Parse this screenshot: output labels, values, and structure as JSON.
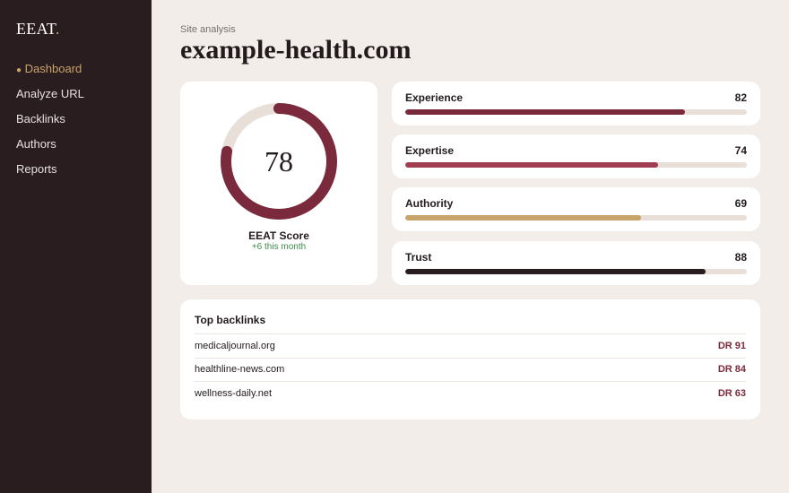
{
  "app": {
    "logo_text": "EEAT",
    "logo_dot": "."
  },
  "sidebar": {
    "items": [
      {
        "label": "Dashboard",
        "active": true
      },
      {
        "label": "Analyze URL"
      },
      {
        "label": "Backlinks"
      },
      {
        "label": "Authors"
      },
      {
        "label": "Reports"
      }
    ],
    "active_marker": "●"
  },
  "header": {
    "eyebrow": "Site analysis",
    "title": "example-health.com"
  },
  "score": {
    "value": "78",
    "label": "EEAT Score",
    "delta": "+6 this month",
    "progress": 0.78,
    "color": "#7b2a3d",
    "track_color": "#e8e0d8"
  },
  "metrics": [
    {
      "name": "Experience",
      "value": "82",
      "progress": 0.82,
      "color": "#7b2a3d"
    },
    {
      "name": "Expertise",
      "value": "74",
      "progress": 0.74,
      "color": "#a13d52"
    },
    {
      "name": "Authority",
      "value": "69",
      "progress": 0.69,
      "color": "#c8a46a"
    },
    {
      "name": "Trust",
      "value": "88",
      "progress": 0.88,
      "color": "#2a1d20"
    }
  ],
  "backlinks": {
    "title": "Top backlinks",
    "rows": [
      {
        "domain": "medicaljournal.org",
        "dr": "DR 91"
      },
      {
        "domain": "healthline-news.com",
        "dr": "DR 84"
      },
      {
        "domain": "wellness-daily.net",
        "dr": "DR 63"
      }
    ]
  }
}
